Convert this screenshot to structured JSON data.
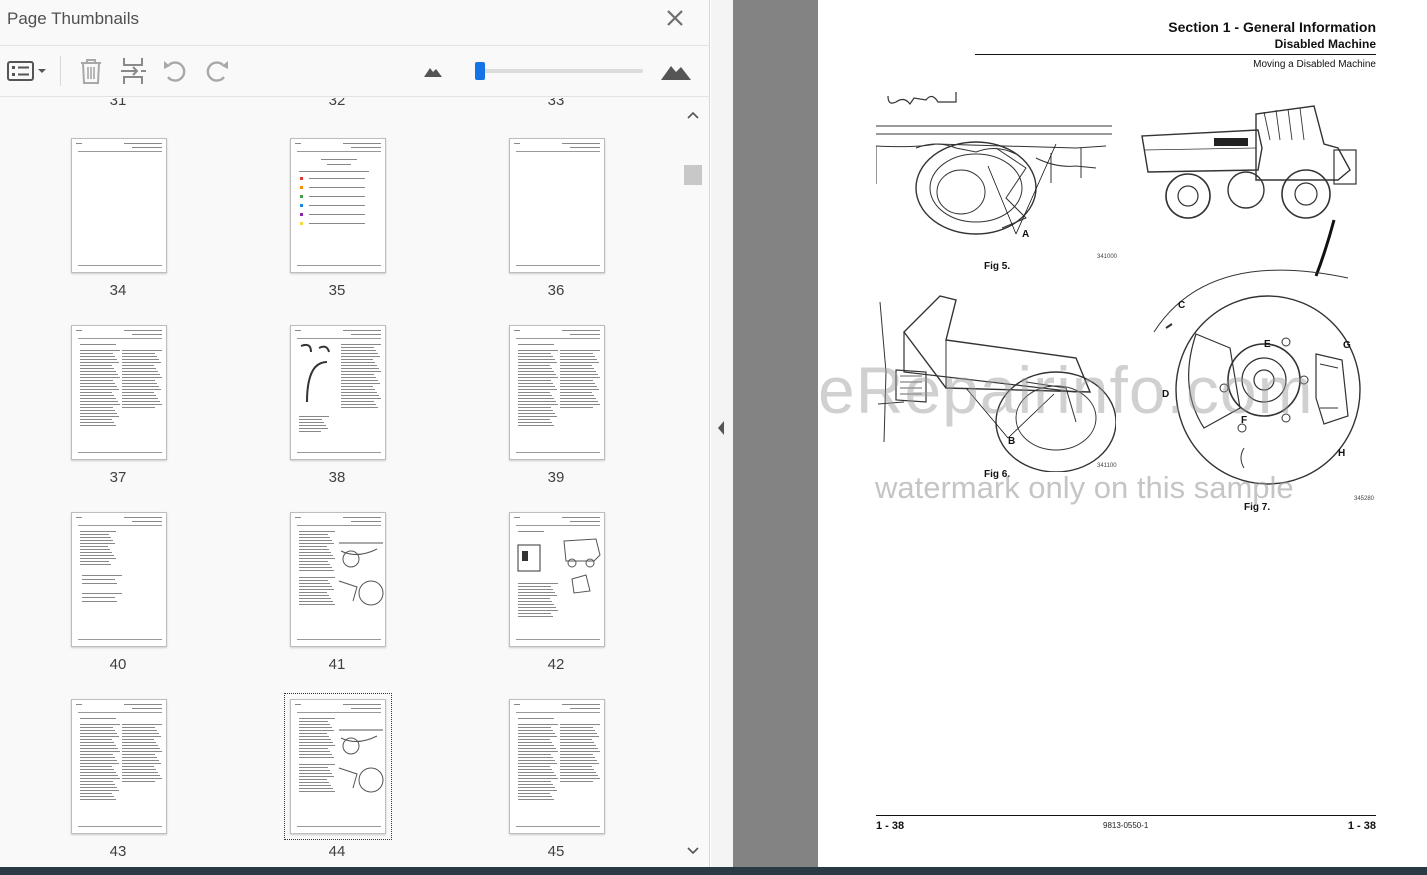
{
  "panel": {
    "title": "Page Thumbnails",
    "close_label": "✕",
    "toolbar": {
      "options_icon": "thumbnail-options-icon",
      "delete_icon": "delete-page-icon",
      "insert_icon": "insert-pages-icon",
      "rotate_ccw_icon": "rotate-counterclockwise-icon",
      "rotate_cw_icon": "rotate-clockwise-icon",
      "zoom_out_icon": "zoom-out-mountain-icon",
      "zoom_in_icon": "zoom-in-mountain-icon",
      "zoom_level": 0
    },
    "partial_row_numbers": [
      "31",
      "32",
      "33"
    ],
    "thumbnails": [
      {
        "num": "34",
        "type": "blank"
      },
      {
        "num": "35",
        "type": "colors"
      },
      {
        "num": "36",
        "type": "blank"
      },
      {
        "num": "37",
        "type": "text"
      },
      {
        "num": "38",
        "type": "hose"
      },
      {
        "num": "39",
        "type": "text"
      },
      {
        "num": "40",
        "type": "list"
      },
      {
        "num": "41",
        "type": "figures"
      },
      {
        "num": "42",
        "type": "truck"
      },
      {
        "num": "43",
        "type": "text"
      },
      {
        "num": "44",
        "type": "figures",
        "selected": true
      },
      {
        "num": "45",
        "type": "text"
      }
    ]
  },
  "document": {
    "header_title": "Section 1 - General Information",
    "header_subtitle": "Disabled Machine",
    "header_section": "Moving a Disabled Machine",
    "fig5_caption": "Fig 5.",
    "fig5_code": "341000",
    "fig6_caption": "Fig 6.",
    "fig6_code": "341100",
    "fig7_caption": "Fig 7.",
    "fig7_code": "345280",
    "labels": [
      "A",
      "B",
      "C",
      "D",
      "E",
      "F",
      "G",
      "H"
    ],
    "footer_left": "1 - 38",
    "footer_center": "9813-0550-1",
    "footer_right": "1 - 38",
    "watermark_main": "eRepairinfo.com",
    "watermark_sub": "watermark only on this sample"
  },
  "colors": {
    "accent": "#1473e6",
    "doc_background": "#838383",
    "bottom_bar": "#2a3a44"
  }
}
